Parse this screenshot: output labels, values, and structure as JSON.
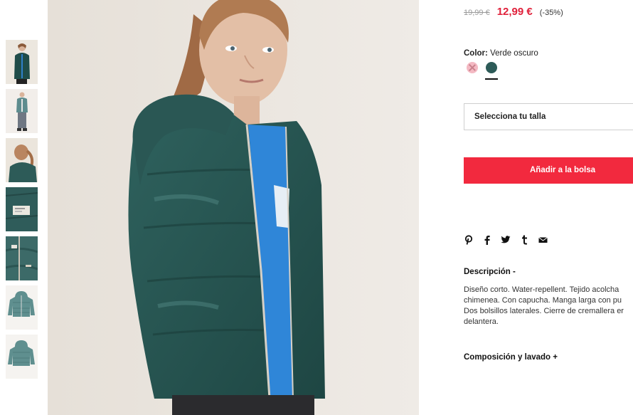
{
  "product": {
    "old_price": "19,99 €",
    "new_price": "12,99 €",
    "discount": "(-35%)",
    "color_label": "Color:",
    "color_value": "Verde oscuro",
    "size_placeholder": "Selecciona tu talla",
    "add_to_bag_label": "Añadir a la bolsa"
  },
  "colors": {
    "accent": "#f2293e",
    "price_red": "#e0203a",
    "jacket_green": "#2d5b58",
    "swatch_pink": "#f4b9c3"
  },
  "swatches": [
    {
      "name": "pink",
      "available": false
    },
    {
      "name": "verde-oscuro",
      "selected": true
    }
  ],
  "share": {
    "icons": [
      "pinterest-icon",
      "facebook-icon",
      "twitter-icon",
      "tumblr-icon",
      "email-icon"
    ]
  },
  "description": {
    "title": "Descripción -",
    "lines": [
      "Diseño corto. Water-repellent. Tejido acolcha",
      "chimenea. Con capucha. Manga larga con pu",
      "Dos bolsillos laterales. Cierre de cremallera er",
      "delantera."
    ]
  },
  "composition": {
    "title": "Composición y lavado +"
  },
  "thumbnails": [
    {
      "name": "thumb-front"
    },
    {
      "name": "thumb-full-body"
    },
    {
      "name": "thumb-back-hood"
    },
    {
      "name": "thumb-label-detail"
    },
    {
      "name": "thumb-zipper-detail"
    },
    {
      "name": "thumb-jacket-front"
    },
    {
      "name": "thumb-jacket-back"
    }
  ]
}
